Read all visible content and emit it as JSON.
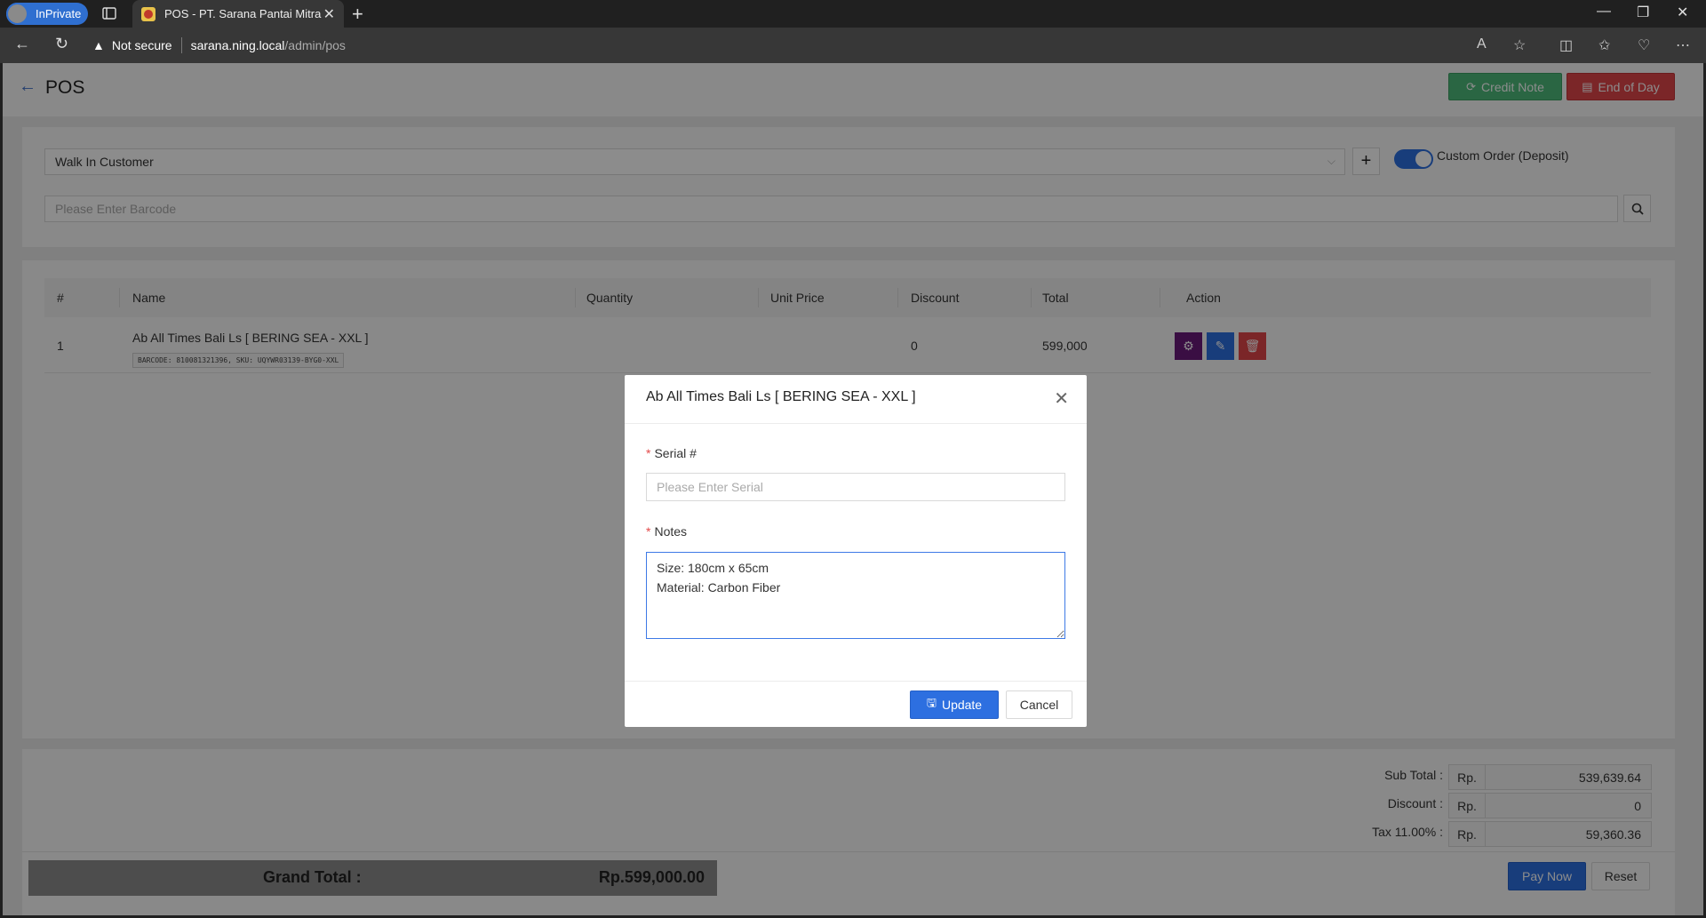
{
  "browser": {
    "inprivate_label": "InPrivate",
    "tab_title": "POS - PT. Sarana Pantai Mitra Se",
    "security_label": "Not secure",
    "url_host": "sarana.ning.local",
    "url_path": "/admin/pos"
  },
  "header": {
    "title": "POS",
    "credit_note_label": "Credit Note",
    "end_of_day_label": "End of Day"
  },
  "customer": {
    "selected": "Walk In Customer",
    "custom_order_label": "Custom Order (Deposit)",
    "custom_order_enabled": true,
    "barcode_placeholder": "Please Enter Barcode"
  },
  "table": {
    "columns": [
      "#",
      "Name",
      "Quantity",
      "Unit Price",
      "Discount",
      "Total",
      "Action"
    ],
    "rows": [
      {
        "no": "1",
        "name": "Ab All Times Bali Ls [ BERING SEA - XXL ]",
        "codes": "BARCODE: 810081321396, SKU: UQYWR03139-BYG0-XXL",
        "discount": "0",
        "total": "599,000"
      }
    ]
  },
  "summary": {
    "subtotal_label": "Sub Total :",
    "discount_label": "Discount :",
    "tax_label": "Tax 11.00% :",
    "currency": "Rp.",
    "subtotal": "539,639.64",
    "discount": "0",
    "tax": "59,360.36",
    "grand_total_label": "Grand Total :",
    "grand_total": "Rp.599,000.00",
    "pay_now_label": "Pay Now",
    "reset_label": "Reset"
  },
  "modal": {
    "title": "Ab All Times Bali Ls [ BERING SEA - XXL ]",
    "serial_label": "Serial #",
    "serial_placeholder": "Please Enter Serial",
    "notes_label": "Notes",
    "notes_value": "Size: 180cm x 65cm\nMaterial: Carbon Fiber",
    "update_label": "Update",
    "cancel_label": "Cancel"
  },
  "colors": {
    "primary": "#2d6fe0",
    "success": "#4dbb7a",
    "danger": "#e0454a",
    "purple": "#6a1b7a"
  }
}
